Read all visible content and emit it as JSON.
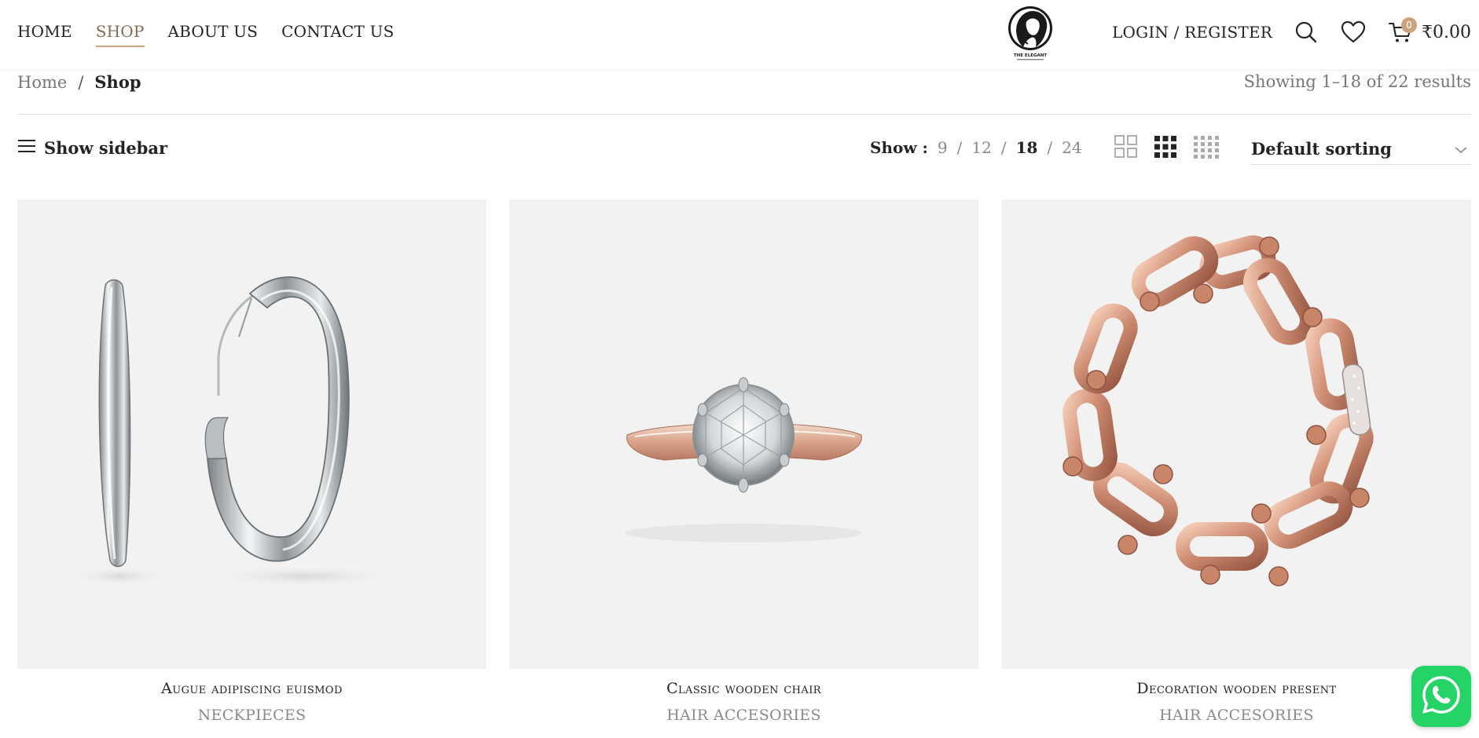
{
  "header": {
    "nav": [
      {
        "label": "HOME"
      },
      {
        "label": "SHOP",
        "active": true
      },
      {
        "label": "ABOUT US"
      },
      {
        "label": "CONTACT US"
      }
    ],
    "logo_text": "THE ELEGANT",
    "login_label": "LOGIN / REGISTER",
    "cart_count": "0",
    "cart_total": "₹0.00",
    "icons": [
      "search-icon",
      "heart-icon",
      "cart-icon"
    ],
    "accent_color": "#c9a27e"
  },
  "breadcrumb": {
    "home": "Home",
    "separator": "/",
    "current": "Shop"
  },
  "results_text": "Showing 1–18 of 22 results",
  "toolbar": {
    "sidebar_label": "Show sidebar",
    "show_label": "Show :",
    "per_page_options": [
      "9",
      "12",
      "18",
      "24"
    ],
    "per_page_selected": "18",
    "view_icons": [
      "grid-2-icon",
      "grid-3-icon",
      "grid-4-icon"
    ],
    "view_selected": "grid-3-icon",
    "sorting_value": "Default sorting"
  },
  "products": [
    {
      "title": "Augue adipiscing euismod",
      "category": "NECKPIECES",
      "image": "silver-hoop-earrings"
    },
    {
      "title": "Classic wooden chair",
      "category": "HAIR ACCESORIES",
      "image": "diamond-solitaire-ring"
    },
    {
      "title": "Decoration wooden present",
      "category": "HAIR ACCESORIES",
      "image": "rose-gold-link-bracelet"
    }
  ],
  "whatsapp": {
    "icon": "whatsapp-icon",
    "color": "#25d366"
  }
}
